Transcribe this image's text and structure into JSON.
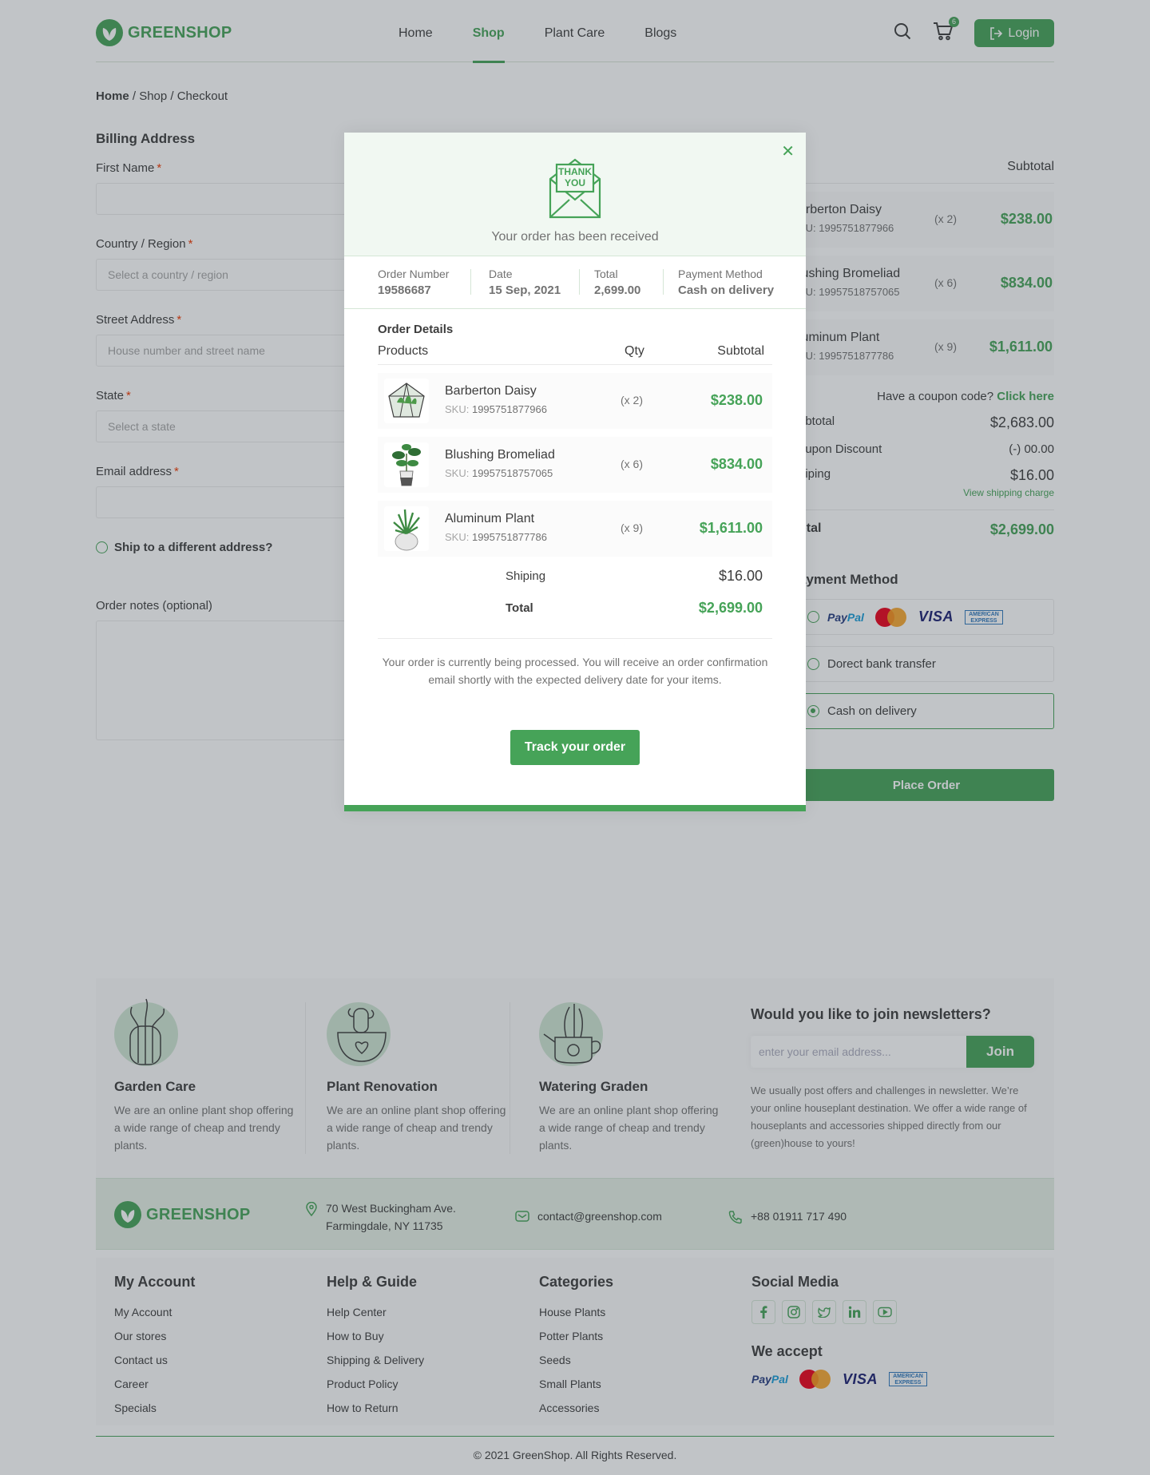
{
  "brand": {
    "name": "GREENSHOP"
  },
  "colors": {
    "accent": "#46a358",
    "text": "#3d3d3d",
    "muted": "#727272",
    "required": "#f03800",
    "overlay": "rgba(50,60,70,0.3)"
  },
  "nav": {
    "items": [
      "Home",
      "Shop",
      "Plant Care",
      "Blogs"
    ],
    "active": "Shop"
  },
  "header": {
    "cart_count": "6",
    "login_label": "Login"
  },
  "breadcrumb": {
    "home": "Home",
    "rest": " / Shop / Checkout"
  },
  "billing": {
    "title": "Billing Address",
    "first_name": "First Name",
    "country": "Country / Region",
    "country_placeholder": "Select a country / region",
    "street": "Street Address",
    "street_placeholder": "House number and street name",
    "state": "State",
    "state_placeholder": "Select a state",
    "email": "Email address",
    "ship_different": "Ship to a different address?",
    "notes": "Order notes (optional)",
    "required_mark": "*"
  },
  "summary": {
    "subtotal_header": "Subtotal",
    "items": [
      {
        "name": "arberton Daisy",
        "sku": "KU: 1995751877966",
        "qty": "(x 2)",
        "price": "$238.00"
      },
      {
        "name": "lushing Bromeliad",
        "sku": "KU: 19957518757065",
        "qty": "(x 6)",
        "price": "$834.00"
      },
      {
        "name": "luminum Plant",
        "sku": "KU: 1995751877786",
        "qty": "(x 9)",
        "price": "$1,611.00"
      }
    ],
    "coupon_text": "Have a coupon code?",
    "coupon_link": "Click here",
    "subtotal_label": "ubtotal",
    "subtotal_value": "$2,683.00",
    "discount_label": "oupon Discount",
    "discount_value": "(-) 00.00",
    "shipping_label": "hiping",
    "shipping_value": "$16.00",
    "shipping_link": "View shipping charge",
    "total_label": "otal",
    "total_value": "$2,699.00",
    "payment_title": "ayment Method",
    "payment_options": [
      "Dorect bank transfer",
      "Cash on delivery"
    ],
    "place_order": "Place Order"
  },
  "cards": {
    "paypal_a": "Pay",
    "paypal_b": "Pal",
    "mastercard": "MasterCard",
    "visa": "VISA",
    "amex": "AMERICAN EXPRESS"
  },
  "modal": {
    "thank_you": "THANK YOU",
    "received": "Your order has been received",
    "info": [
      {
        "label": "Order Number",
        "value": "19586687"
      },
      {
        "label": "Date",
        "value": "15 Sep, 2021"
      },
      {
        "label": "Total",
        "value": "2,699.00"
      },
      {
        "label": "Payment Method",
        "value": "Cash on delivery"
      }
    ],
    "details_title": "Order Details",
    "col_products": "Products",
    "col_qty": "Qty",
    "col_subtotal": "Subtotal",
    "items": [
      {
        "name": "Barberton Daisy",
        "sku_label": "SKU:",
        "sku": "1995751877966",
        "qty": "(x 2)",
        "price": "$238.00"
      },
      {
        "name": "Blushing Bromeliad",
        "sku_label": "SKU:",
        "sku": "19957518757065",
        "qty": "(x 6)",
        "price": "$834.00"
      },
      {
        "name": "Aluminum Plant",
        "sku_label": "SKU:",
        "sku": "1995751877786",
        "qty": "(x 9)",
        "price": "$1,611.00"
      }
    ],
    "shipping_label": "Shiping",
    "shipping_value": "$16.00",
    "total_label": "Total",
    "total_value": "$2,699.00",
    "message": "Your order is currently being processed. You will receive an order confirmation email shortly with the expected delivery date for your items.",
    "track_label": "Track your order"
  },
  "features": [
    {
      "title": "Garden Care",
      "text": "We are an online plant shop offering a wide range of cheap and trendy plants."
    },
    {
      "title": "Plant Renovation",
      "text": "We are an online plant shop offering a wide range of cheap and trendy plants."
    },
    {
      "title": "Watering Graden",
      "text": "We are an online plant shop offering a wide range of cheap and trendy plants."
    }
  ],
  "newsletter": {
    "title": "Would you like to join newsletters?",
    "placeholder": "enter your email address...",
    "join": "Join",
    "text": "We usually post offers and challenges in newsletter. We’re your online houseplant destination. We offer a wide range of houseplants and accessories shipped directly from our (green)house to yours!"
  },
  "contact": {
    "address_1": "70 West Buckingham Ave.",
    "address_2": "Farmingdale, NY 11735",
    "email": "contact@greenshop.com",
    "phone": "+88 01911 717 490"
  },
  "footer_links": [
    {
      "title": "My Account",
      "items": [
        "My Account",
        "Our stores",
        "Contact us",
        "Career",
        "Specials"
      ]
    },
    {
      "title": "Help & Guide",
      "items": [
        "Help Center",
        "How to Buy",
        "Shipping & Delivery",
        "Product Policy",
        "How to Return"
      ]
    },
    {
      "title": "Categories",
      "items": [
        "House Plants",
        "Potter Plants",
        "Seeds",
        "Small Plants",
        "Accessories"
      ]
    }
  ],
  "social": {
    "title": "Social Media",
    "icons": [
      "facebook-icon",
      "instagram-icon",
      "twitter-icon",
      "linkedin-icon",
      "youtube-icon"
    ],
    "accept_title": "We accept"
  },
  "copyright": "© 2021 GreenShop. All Rights Reserved."
}
